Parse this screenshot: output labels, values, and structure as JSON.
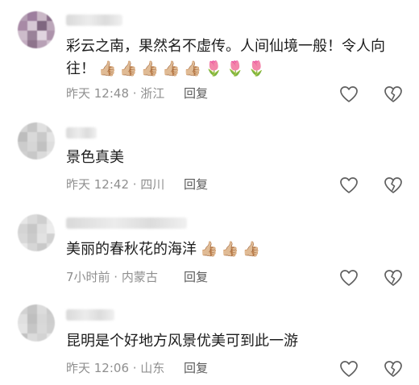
{
  "comments": [
    {
      "text": "彩云之南，果然名不虚传。人间仙境一般！令人向往！",
      "emojis": [
        "👍🏼",
        "👍🏼",
        "👍🏼",
        "👍🏼",
        "👍🏼",
        "🌷",
        "🌷",
        "🌷"
      ],
      "time_loc": "昨天 12:48 · 浙江",
      "reply_label": "回复",
      "avatar_colors": [
        "#b59fb4",
        "#9d7e9e",
        "#c9b7c6",
        "#8a6e8a",
        "#a88aa6",
        "#d6c8d5",
        "#7f6680",
        "#bba6b9",
        "#cdbccb",
        "#9a8299",
        "#e0d4df",
        "#ad93ab",
        "#c3adc1",
        "#8e748c",
        "#b8a1b6",
        "#d1c1cf"
      ]
    },
    {
      "text": "景色真美",
      "emojis": [],
      "time_loc": "昨天 12:42 · 四川",
      "reply_label": "回复",
      "avatar_colors": [
        "#d4d4d4",
        "#c6c6c6",
        "#e0e0e0",
        "#cfcfcf",
        "#bdbdbd",
        "#d9d9d9",
        "#c9c9c9",
        "#e3e3e3",
        "#cccccc",
        "#d6d6d6",
        "#c1c1c1",
        "#dedede",
        "#d0d0d0",
        "#c8c8c8",
        "#dbdbdb",
        "#e5e5e5"
      ]
    },
    {
      "text": "美丽的春秋花的海洋",
      "emojis": [
        "👍🏼",
        "👍🏼",
        "👍🏼"
      ],
      "time_loc": "7小时前 · 内蒙古",
      "reply_label": "回复",
      "avatar_colors": [
        "#e6e6e6",
        "#dadada",
        "#cfcfcf",
        "#e9e9e9",
        "#d4d4d4",
        "#c7c7c7",
        "#dedede",
        "#ececec",
        "#d8d8d8",
        "#cbcbcb",
        "#e2e2e2",
        "#d1d1d1",
        "#e8e8e8",
        "#d6d6d6",
        "#c9c9c9",
        "#dfdfdf"
      ]
    },
    {
      "text": "昆明是个好地方风景优美可到此一游",
      "emojis": [],
      "time_loc": "昨天 12:06 · 山东",
      "reply_label": "回复",
      "avatar_colors": [
        "#d2d2d2",
        "#c4c4c4",
        "#dcdcdc",
        "#cacaca",
        "#e0e0e0",
        "#bfbfbf",
        "#d7d7d7",
        "#cdcdcd",
        "#e4e4e4",
        "#c6c6c6",
        "#d9d9d9",
        "#cfcfcf",
        "#c2c2c2",
        "#dbdbdb",
        "#d3d3d3",
        "#e6e6e6"
      ]
    }
  ]
}
